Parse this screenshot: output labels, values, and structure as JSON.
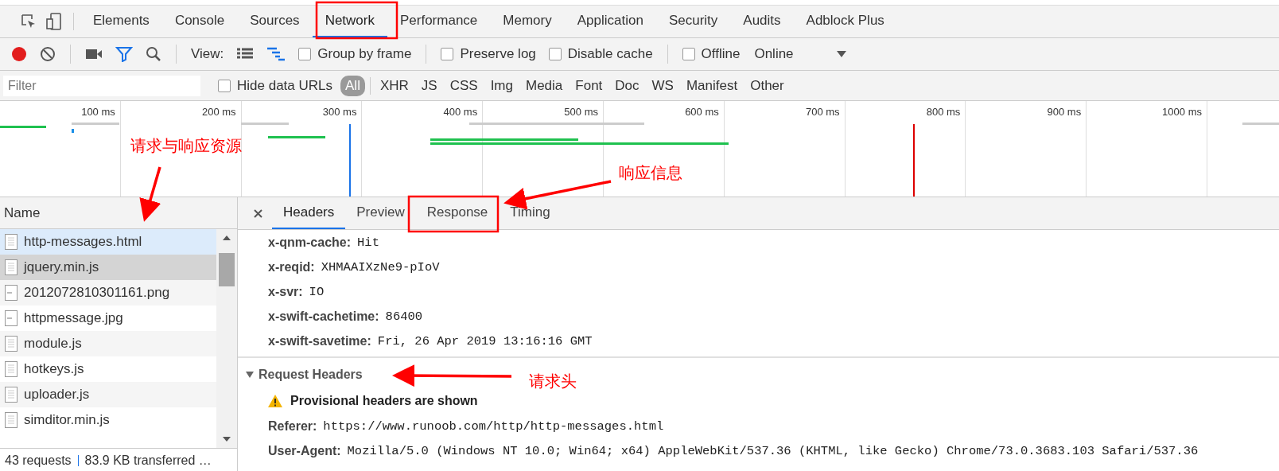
{
  "panel_tabs": [
    {
      "label": "Elements",
      "selected": false
    },
    {
      "label": "Console",
      "selected": false
    },
    {
      "label": "Sources",
      "selected": false
    },
    {
      "label": "Network",
      "selected": true
    },
    {
      "label": "Performance",
      "selected": false
    },
    {
      "label": "Memory",
      "selected": false
    },
    {
      "label": "Application",
      "selected": false
    },
    {
      "label": "Security",
      "selected": false
    },
    {
      "label": "Audits",
      "selected": false
    },
    {
      "label": "Adblock Plus",
      "selected": false
    }
  ],
  "toolbar": {
    "recording": true,
    "filter_on": true,
    "view_label": "View:",
    "waterfall_view": true,
    "checkboxes": [
      {
        "label": "Group by frame",
        "checked": false
      },
      {
        "label": "Preserve log",
        "checked": false
      },
      {
        "label": "Disable cache",
        "checked": false
      },
      {
        "label": "Offline",
        "checked": false
      }
    ],
    "throttling": "Online"
  },
  "filter_bar": {
    "placeholder": "Filter",
    "hide_data_urls": {
      "label": "Hide data URLs",
      "checked": false
    },
    "types": [
      {
        "label": "All",
        "selected": true
      },
      {
        "label": "XHR",
        "selected": false
      },
      {
        "label": "JS",
        "selected": false
      },
      {
        "label": "CSS",
        "selected": false
      },
      {
        "label": "Img",
        "selected": false
      },
      {
        "label": "Media",
        "selected": false
      },
      {
        "label": "Font",
        "selected": false
      },
      {
        "label": "Doc",
        "selected": false
      },
      {
        "label": "WS",
        "selected": false
      },
      {
        "label": "Manifest",
        "selected": false
      },
      {
        "label": "Other",
        "selected": false
      }
    ]
  },
  "overview": {
    "ticks": [
      "100 ms",
      "200 ms",
      "300 ms",
      "400 ms",
      "500 ms",
      "600 ms",
      "700 ms",
      "800 ms",
      "900 ms",
      "1000 ms"
    ]
  },
  "requests": {
    "column": "Name",
    "rows": [
      {
        "name": "http-messages.html",
        "kind": "doc",
        "selected": true,
        "hovered": false
      },
      {
        "name": "jquery.min.js",
        "kind": "doc",
        "selected": false,
        "hovered": true
      },
      {
        "name": "2012072810301161.png",
        "kind": "image",
        "selected": false,
        "hovered": false
      },
      {
        "name": "httpmessage.jpg",
        "kind": "image",
        "selected": false,
        "hovered": false
      },
      {
        "name": "module.js",
        "kind": "doc",
        "selected": false,
        "hovered": false
      },
      {
        "name": "hotkeys.js",
        "kind": "doc",
        "selected": false,
        "hovered": false
      },
      {
        "name": "uploader.js",
        "kind": "doc",
        "selected": false,
        "hovered": false
      },
      {
        "name": "simditor.min.js",
        "kind": "doc",
        "selected": false,
        "hovered": false
      }
    ],
    "status": {
      "count": "43 requests",
      "transferred": "83.9 KB transferred …"
    }
  },
  "detail": {
    "tabs": [
      {
        "label": "Headers",
        "selected": true
      },
      {
        "label": "Preview",
        "selected": false
      },
      {
        "label": "Response",
        "selected": false
      },
      {
        "label": "Timing",
        "selected": false
      }
    ],
    "response_headers": [
      {
        "key": "x-qnm-cache:",
        "value": "Hit"
      },
      {
        "key": "x-reqid:",
        "value": "XHMAAIXzNe9-pIoV"
      },
      {
        "key": "x-svr:",
        "value": "IO"
      },
      {
        "key": "x-swift-cachetime:",
        "value": "86400"
      },
      {
        "key": "x-swift-savetime:",
        "value": "Fri, 26 Apr 2019 13:16:16 GMT"
      }
    ],
    "request_section": {
      "title": "Request Headers",
      "expanded": true,
      "warning": "Provisional headers are shown",
      "headers": [
        {
          "key": "Referer:",
          "value": "https://www.runoob.com/http/http-messages.html"
        },
        {
          "key": "User-Agent:",
          "value": "Mozilla/5.0 (Windows NT 10.0; Win64; x64) AppleWebKit/537.36 (KHTML, like Gecko) Chrome/73.0.3683.103 Safari/537.36"
        }
      ]
    }
  },
  "annotations": [
    {
      "text": "请求与响应资源"
    },
    {
      "text": "响应信息"
    },
    {
      "text": "请求头"
    }
  ]
}
